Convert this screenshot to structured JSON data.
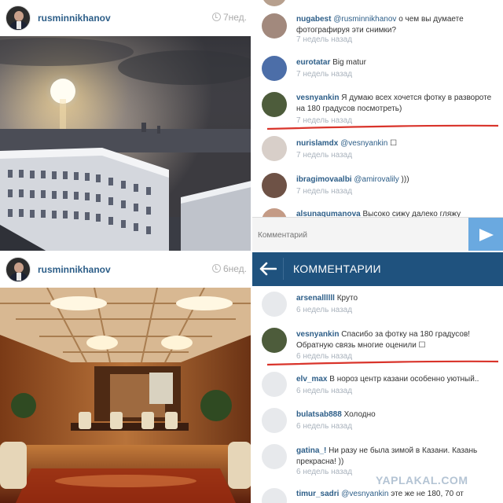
{
  "top_left": {
    "username": "rusminnikhanov",
    "time": "7нед."
  },
  "top_right": {
    "comments": [
      {
        "user": "nugabest",
        "mention": "@rusminnikhanov",
        "text": " о чем вы думаете фотографируя эти снимки?",
        "time": "7 недель назад"
      },
      {
        "user": "eurotatar",
        "mention": "",
        "text": "Big matur",
        "time": "7 недель назад"
      },
      {
        "user": "vesnyankin",
        "mention": "",
        "text": "Я думаю всех хочется фотку в развороте на 180 градусов посмотреть)",
        "time": "7 недель назад"
      },
      {
        "user": "nurislamdx",
        "mention": "@vesnyankin",
        "text": " ☐",
        "time": "7 недель назад"
      },
      {
        "user": "ibragimovaalbi",
        "mention": "@amirovalily",
        "text": " )))",
        "time": "7 недель назад"
      },
      {
        "user": "alsunaqumanova",
        "mention": "",
        "text": "Высоко сижу далеко гляжу",
        "time": ""
      }
    ],
    "comment_placeholder": "Комментарий"
  },
  "bottom_left": {
    "username": "rusminnikhanov",
    "time": "6нед."
  },
  "bottom_right": {
    "header_title": "КОММЕНТАРИИ",
    "comments": [
      {
        "user": "arsenallllll",
        "mention": "",
        "text": "Круто",
        "time": "6 недель назад"
      },
      {
        "user": "vesnyankin",
        "mention": "",
        "text": "Спасибо за фотку на 180 градусов! Обратную связь многие оценили ☐",
        "time": "6 недель назад"
      },
      {
        "user": "elv_max",
        "mention": "",
        "text": "В нороз центр казани особенно уютный..",
        "time": "6 недель назад"
      },
      {
        "user": "bulatsab888",
        "mention": "",
        "text": "Холодно",
        "time": "6 недель назад"
      },
      {
        "user": "gatina_!",
        "mention": "",
        "text": "Ни разу не была зимой в Казани. Казань прекрасна! ))",
        "time": "6 недель назад"
      },
      {
        "user": "timur_sadri",
        "mention": "@vesnyankin",
        "text": " эте же не 180, 70 от",
        "time": ""
      }
    ]
  },
  "watermark": "YAPLAKAL.COM",
  "colors": {
    "username": "#2d5e88",
    "header_bar": "#1f527e",
    "send_button": "#6aa9e0",
    "underline": "#d9342b"
  }
}
